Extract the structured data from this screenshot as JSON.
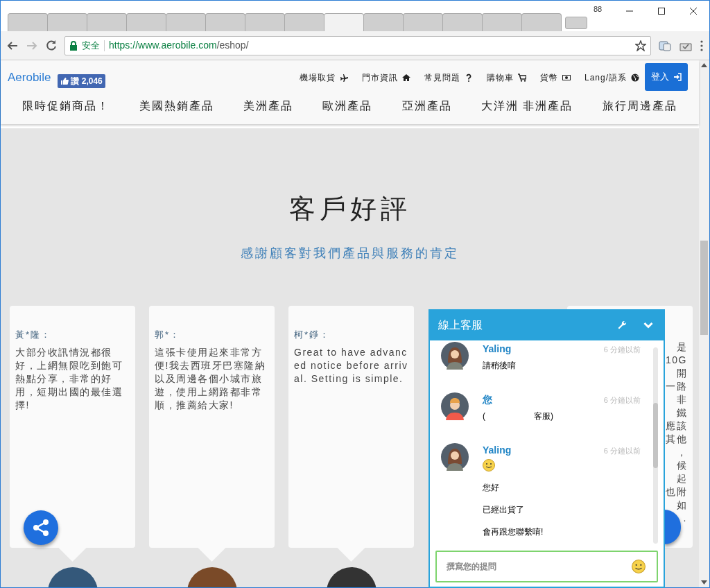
{
  "browser": {
    "tab_count": "88",
    "tabs": [
      {
        "selected": false
      },
      {
        "selected": false
      },
      {
        "selected": false
      },
      {
        "selected": false
      },
      {
        "selected": false
      },
      {
        "selected": false
      },
      {
        "selected": false
      },
      {
        "selected": false
      },
      {
        "selected": true
      },
      {
        "selected": false
      },
      {
        "selected": false
      },
      {
        "selected": false
      },
      {
        "selected": false
      },
      {
        "selected": false
      }
    ],
    "security": "安全",
    "url_host": "https://www.aerobile.com",
    "url_path": "/eshop/"
  },
  "header": {
    "logo": "Aerobile",
    "like_count": "讚 2,046",
    "links": [
      {
        "label": "機場取貨"
      },
      {
        "label": "門市資訊"
      },
      {
        "label": "常見問題"
      },
      {
        "label": "購物車"
      },
      {
        "label": "貨幣"
      },
      {
        "label": "Lang/語系"
      }
    ],
    "login": "登入"
  },
  "nav": [
    "限時促銷商品！",
    "美國熱銷產品",
    "美洲產品",
    "歐洲產品",
    "亞洲產品",
    "大洋洲 非洲產品",
    "旅行周邊產品"
  ],
  "section": {
    "title": "客戶好評",
    "subtitle": "感謝顧客對我們產品與服務的肯定"
  },
  "reviews": [
    {
      "name": "黃*隆：",
      "text": "大部分收訊情況都很好，上網無限吃到飽可熱點分享，非常的好用，短期出國的最佳選擇!"
    },
    {
      "name": "郭*：",
      "text": "這張卡使用起來非常方便!我去西班牙巴塞隆納以及周邊各個小城市旅遊，使用上網路都非常順，推薦給大家!"
    },
    {
      "name": "柯*錚：",
      "text": "Great to have advanced notice before arrival. Setting is simple."
    }
  ],
  "hidden_review_lines": [
    "是",
    "10G",
    "開",
    "一路",
    "非",
    "鐵",
    "應該",
    "其他",
    "，",
    "候",
    "起",
    "也附",
    "如",
    "."
  ],
  "chat": {
    "title": "線上客服",
    "messages": [
      {
        "kind": "agent",
        "sender": "Yaling",
        "time": "6 分鐘以前",
        "emoji": false,
        "lines": [
          "請稍後唷"
        ]
      },
      {
        "kind": "customer",
        "sender": "您",
        "time": "6 分鐘以前",
        "emoji": false,
        "lines": [
          "(",
          "客服)"
        ]
      },
      {
        "kind": "agent",
        "sender": "Yaling",
        "time": "6 分鐘以前",
        "emoji": true,
        "lines": [
          "您好",
          "已經出貨了",
          "會再跟您聯繫唷!"
        ]
      }
    ],
    "input_placeholder": "撰寫您的提問"
  }
}
